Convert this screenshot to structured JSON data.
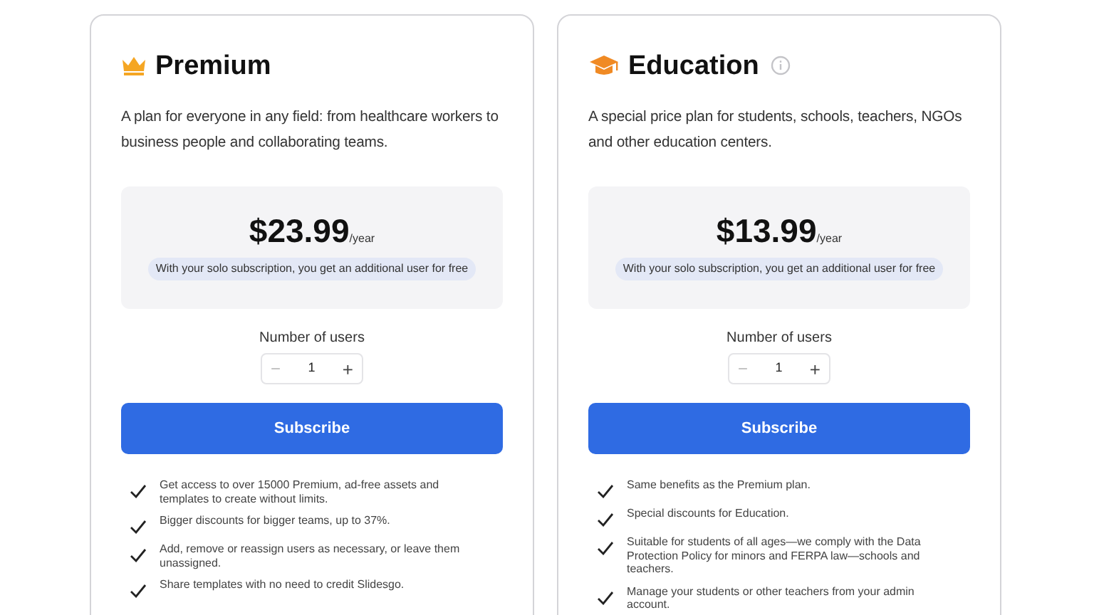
{
  "plans": [
    {
      "kind": "crown",
      "name": "Premium",
      "info": false,
      "description": "A plan for everyone in any field: from healthcare workers to business people and collaborating teams.",
      "price": "$23.99",
      "period": "/year",
      "note": "With your solo subscription, you get an additional user for free",
      "users_label": "Number of users",
      "minus": "−",
      "users": "1",
      "plus": "+",
      "button": "Subscribe",
      "features": [
        "Get access to over 15000 Premium, ad-free assets and templates to create without limits.",
        "Bigger discounts for bigger teams, up to 37%.",
        "Add, remove or reassign users as necessary, or leave them unassigned.",
        "Share templates with no need to credit Slidesgo."
      ]
    },
    {
      "kind": "cap",
      "name": "Education",
      "info": true,
      "description": "A special price plan for students, schools, teachers, NGOs and other education centers.",
      "price": "$13.99",
      "period": "/year",
      "note": "With your solo subscription, you get an additional user for free",
      "users_label": "Number of users",
      "minus": "−",
      "users": "1",
      "plus": "+",
      "button": "Subscribe",
      "features": [
        "Same benefits as the Premium plan.",
        "Special discounts for Education.",
        "Suitable for students of all ages—we comply with the Data Protection Policy for minors and FERPA law—schools and teachers.",
        "Manage your students or other teachers from your admin account."
      ]
    }
  ]
}
